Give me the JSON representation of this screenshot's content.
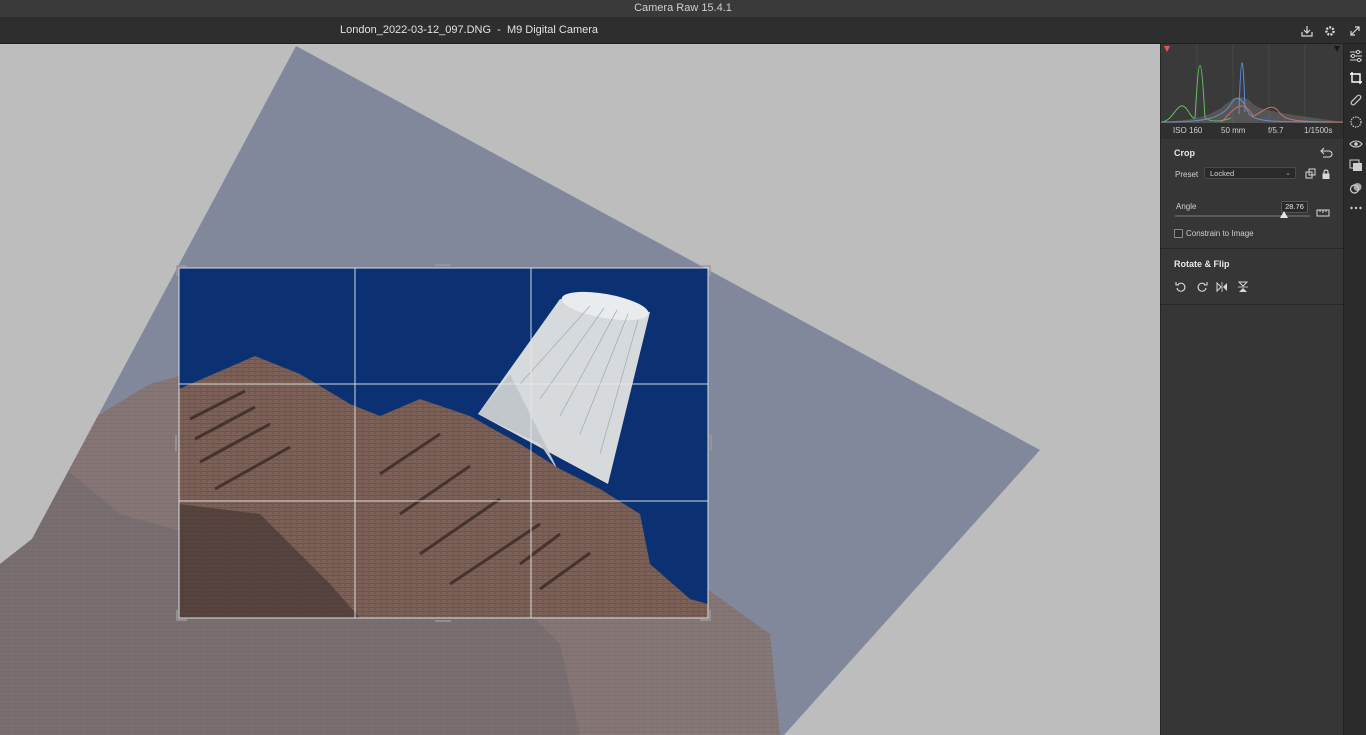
{
  "app": {
    "title": "Camera Raw 15.4.1"
  },
  "infobar": {
    "filename": "London_2022-03-12_097.DNG  -  M9 Digital Camera"
  },
  "exif": {
    "iso": "ISO 160",
    "focal": "50 mm",
    "aperture": "f/5.7",
    "shutter": "1/1500s"
  },
  "crop": {
    "title": "Crop",
    "preset_label": "Preset",
    "preset_value": "Locked",
    "angle_label": "Angle",
    "angle_value": "28.76",
    "constrain_label": "Constrain to Image",
    "constrain_checked": false
  },
  "rotate_flip": {
    "title": "Rotate & Flip"
  },
  "icons": {
    "top": [
      "download-icon",
      "gear-icon",
      "expand-icon"
    ],
    "toolstrip": [
      "edit-sliders-icon",
      "crop-icon",
      "healing-brush-icon",
      "masking-icon",
      "red-eye-icon",
      "snapshots-icon",
      "presets-icon",
      "more-icon"
    ],
    "crop_panel": [
      "reset-icon",
      "aspect-ratio-icon",
      "lock-icon",
      "straighten-tool-icon"
    ],
    "rotate_flip": [
      "rotate-left-icon",
      "rotate-right-icon",
      "flip-horizontal-icon",
      "flip-vertical-icon"
    ]
  },
  "colors": {
    "sky": "#0b3173",
    "overlay_sky": "#737b93",
    "brick": "#7c6257",
    "panel": "#363636",
    "canvas": "#bdbdbd"
  }
}
